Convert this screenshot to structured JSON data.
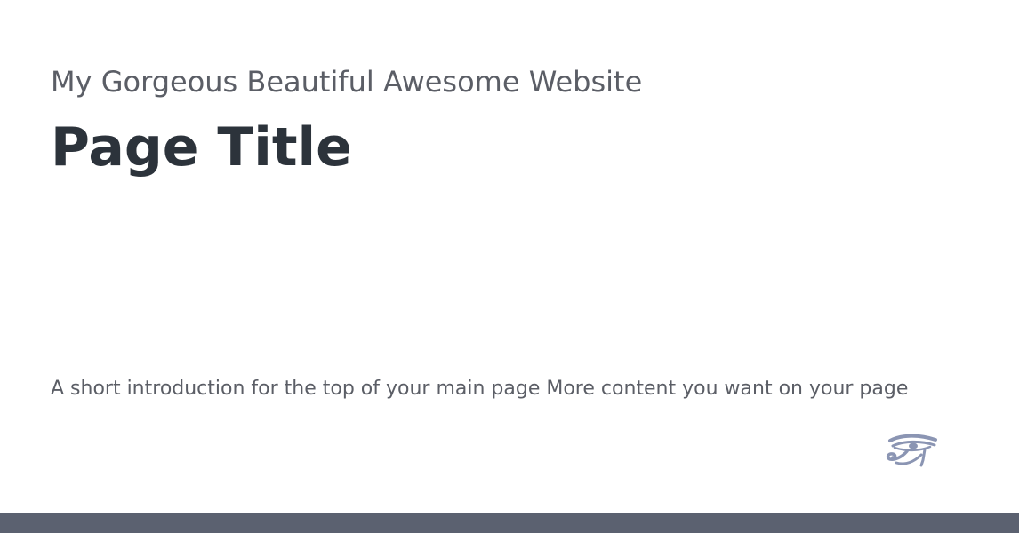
{
  "header": {
    "site_name": "My Gorgeous Beautiful Awesome Website",
    "page_title": "Page Title"
  },
  "main": {
    "intro_text": "A short introduction for the top of your main page More content you want on your page"
  },
  "logo": {
    "icon": "eye-of-horus-icon",
    "color": "#8b95b3"
  },
  "footer": {
    "bar_color": "#5b6170"
  }
}
